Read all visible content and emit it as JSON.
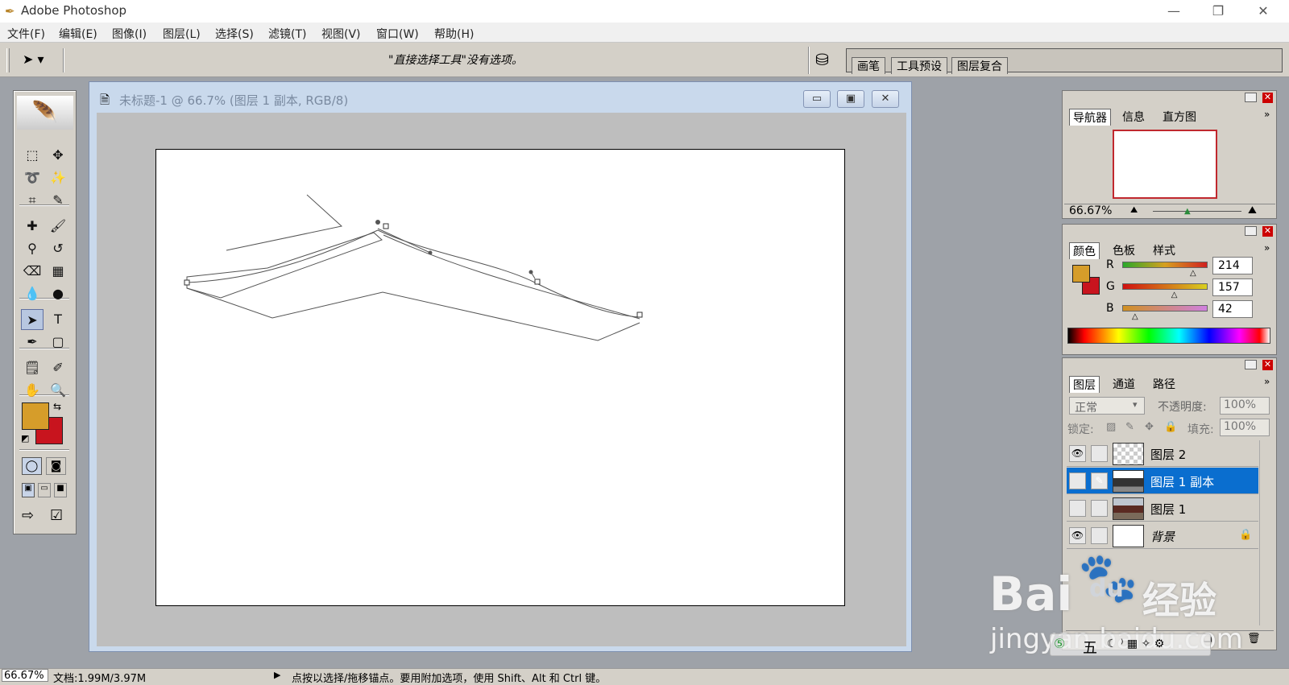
{
  "window": {
    "title": "Adobe Photoshop",
    "min": "—",
    "restore": "❐",
    "close": "✕"
  },
  "menu": [
    "文件(F)",
    "编辑(E)",
    "图像(I)",
    "图层(L)",
    "选择(S)",
    "滤镜(T)",
    "视图(V)",
    "窗口(W)",
    "帮助(H)"
  ],
  "options": {
    "message": "\"直接选择工具\"没有选项。",
    "tabs": [
      "画笔",
      "工具预设",
      "图层复合"
    ]
  },
  "document": {
    "title": "未标题-1 @ 66.7% (图层 1 副本, RGB/8)",
    "btn_min": "▭",
    "btn_max": "▣",
    "btn_close": "✕"
  },
  "navigator": {
    "tabs": [
      "导航器",
      "信息",
      "直方图"
    ],
    "zoom": "66.67%",
    "zoom_slider": 0.4
  },
  "color": {
    "tabs": [
      "颜色",
      "色板",
      "样式"
    ],
    "foreground": "#d69d2a",
    "background": "#c8141e",
    "channels": [
      {
        "label": "R",
        "value": "214",
        "fraction": 0.84
      },
      {
        "label": "G",
        "value": "157",
        "fraction": 0.62
      },
      {
        "label": "B",
        "value": "42",
        "fraction": 0.16
      }
    ]
  },
  "layers": {
    "tabs": [
      "图层",
      "通道",
      "路径"
    ],
    "blend_mode": "正常",
    "opacity_label": "不透明度:",
    "opacity": "100%",
    "lock_label": "锁定:",
    "fill_label": "填充:",
    "fill": "100%",
    "items": [
      {
        "name": "图层 2",
        "visible": true,
        "selected": false,
        "thumb": "checker"
      },
      {
        "name": "图层 1 副本",
        "visible": false,
        "selected": true,
        "thumb": "photo"
      },
      {
        "name": "图层 1",
        "visible": false,
        "selected": false,
        "thumb": "photo"
      },
      {
        "name": "背景",
        "visible": true,
        "selected": false,
        "thumb": "white",
        "locked": true
      }
    ]
  },
  "toolbox": {
    "tools": [
      {
        "name": "marquee-tool-icon",
        "glyph": "⬚"
      },
      {
        "name": "move-tool-icon",
        "glyph": "✥"
      },
      {
        "name": "lasso-tool-icon",
        "glyph": "➰"
      },
      {
        "name": "magic-wand-icon",
        "glyph": "✨"
      },
      {
        "name": "crop-tool-icon",
        "glyph": "⌗"
      },
      {
        "name": "slice-tool-icon",
        "glyph": "✎"
      },
      {
        "name": "healing-brush-icon",
        "glyph": "✚"
      },
      {
        "name": "brush-tool-icon",
        "glyph": "🖌"
      },
      {
        "name": "clone-stamp-icon",
        "glyph": "⚲"
      },
      {
        "name": "history-brush-icon",
        "glyph": "↺"
      },
      {
        "name": "eraser-tool-icon",
        "glyph": "⌫"
      },
      {
        "name": "gradient-tool-icon",
        "glyph": "▦"
      },
      {
        "name": "blur-tool-icon",
        "glyph": "💧"
      },
      {
        "name": "dodge-tool-icon",
        "glyph": "●"
      },
      {
        "name": "direct-selection-icon",
        "glyph": "➤"
      },
      {
        "name": "type-tool-icon",
        "glyph": "T"
      },
      {
        "name": "pen-tool-icon",
        "glyph": "✒"
      },
      {
        "name": "shape-tool-icon",
        "glyph": "▢"
      },
      {
        "name": "notes-tool-icon",
        "glyph": "🗒"
      },
      {
        "name": "eyedropper-icon",
        "glyph": "✐"
      },
      {
        "name": "hand-tool-icon",
        "glyph": "✋"
      },
      {
        "name": "zoom-tool-icon",
        "glyph": "🔍"
      }
    ]
  },
  "status": {
    "zoom": "66.67%",
    "doc": "文档:1.99M/3.97M",
    "arrow": "▶",
    "hint": "点按以选择/拖移锚点。要用附加选项，使用 Shift、Alt 和 Ctrl 键。"
  },
  "watermark": {
    "brand": "Bai",
    "brand2": "du",
    "cn": "经验",
    "url": "jingyan.baidu.com"
  },
  "ime_bar": "五"
}
